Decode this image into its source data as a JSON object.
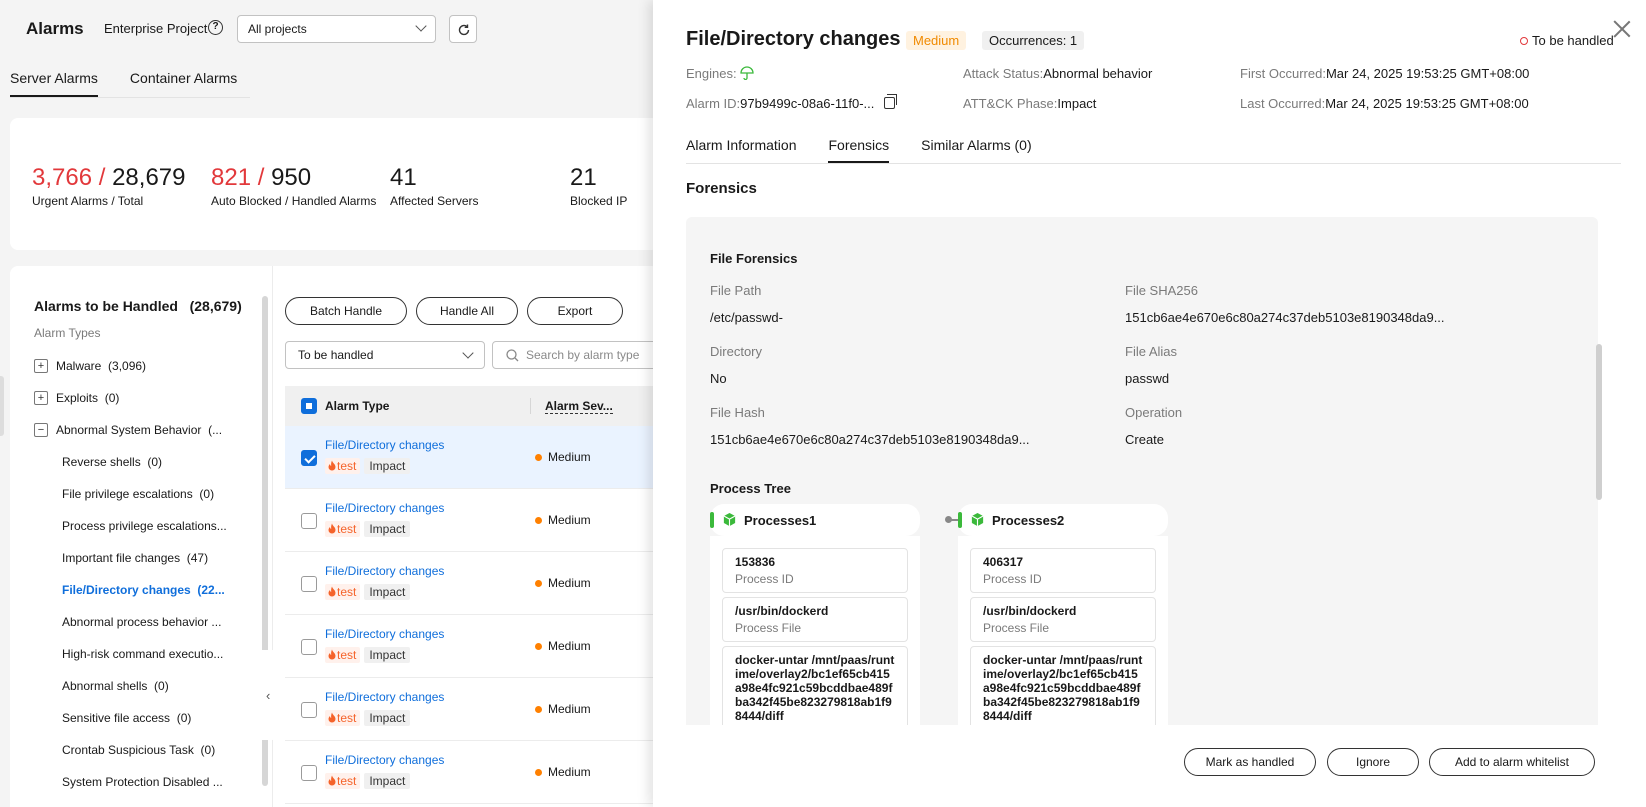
{
  "page": {
    "title": "Alarms",
    "enterprise_project_label": "Enterprise Project",
    "help_glyph": "?",
    "project_select_value": "All projects",
    "tabs": [
      "Server Alarms",
      "Container Alarms"
    ]
  },
  "stats": [
    {
      "value_red": "3,766",
      "sep": " / ",
      "value": "28,679",
      "label": "Urgent Alarms  / Total"
    },
    {
      "value_red": "821",
      "sep": " / ",
      "value": "950",
      "label": "Auto Blocked  / Handled Alarms"
    },
    {
      "value_red": "",
      "sep": "",
      "value": "41",
      "label": "Affected Servers"
    },
    {
      "value_red": "",
      "sep": "",
      "value": "21",
      "label": "Blocked IP"
    }
  ],
  "alarm_list": {
    "title": "Alarms to be Handled",
    "count": "(28,679)",
    "subtitle": "Alarm Types",
    "tree": [
      {
        "label": "Malware",
        "count": "(3,096)",
        "expand": "+"
      },
      {
        "label": "Exploits",
        "count": "(0)",
        "expand": "+"
      },
      {
        "label": "Abnormal System Behavior",
        "count": "(...",
        "expand": "−"
      },
      {
        "label": "Reverse shells",
        "count": "(0)"
      },
      {
        "label": "File privilege escalations",
        "count": "(0)"
      },
      {
        "label": "Process privilege escalations...",
        "count": ""
      },
      {
        "label": "Important file changes",
        "count": "(47)"
      },
      {
        "label": "File/Directory changes",
        "count": "(22...",
        "active": true
      },
      {
        "label": "Abnormal process behavior ...",
        "count": ""
      },
      {
        "label": "High-risk command executio...",
        "count": ""
      },
      {
        "label": "Abnormal shells",
        "count": "(0)"
      },
      {
        "label": "Sensitive file access",
        "count": "(0)"
      },
      {
        "label": "Crontab Suspicious Task",
        "count": "(0)"
      },
      {
        "label": "System Protection Disabled ...",
        "count": ""
      }
    ],
    "collapse_glyph": "‹"
  },
  "toolbar": {
    "batch_handle": "Batch Handle",
    "handle_all": "Handle All",
    "export": "Export",
    "status_filter": "To be handled",
    "search_placeholder": "Search by alarm type"
  },
  "table": {
    "headers": [
      "Alarm Type",
      "Alarm Sev..."
    ],
    "rows": [
      {
        "name": "File/Directory changes",
        "tag1": "test",
        "tag2": "Impact",
        "severity": "Medium",
        "checked": true
      },
      {
        "name": "File/Directory changes",
        "tag1": "test",
        "tag2": "Impact",
        "severity": "Medium",
        "checked": false
      },
      {
        "name": "File/Directory changes",
        "tag1": "test",
        "tag2": "Impact",
        "severity": "Medium",
        "checked": false
      },
      {
        "name": "File/Directory changes",
        "tag1": "test",
        "tag2": "Impact",
        "severity": "Medium",
        "checked": false
      },
      {
        "name": "File/Directory changes",
        "tag1": "test",
        "tag2": "Impact",
        "severity": "Medium",
        "checked": false
      },
      {
        "name": "File/Directory changes",
        "tag1": "test",
        "tag2": "Impact",
        "severity": "Medium",
        "checked": false
      }
    ]
  },
  "drawer": {
    "title": "File/Directory changes",
    "severity_badge": "Medium",
    "occurrences": "Occurrences: 1",
    "status": "To be handled",
    "meta": {
      "engines_label": "Engines:",
      "alarm_id_label": "Alarm ID:",
      "alarm_id": "97b9499c-08a6-11f0-...",
      "attack_status_label": "Attack Status:",
      "attack_status": "Abnormal behavior",
      "attck_phase_label": "ATT&CK Phase:",
      "attck_phase": "Impact",
      "first_occurred_label": "First Occurred:",
      "first_occurred": "Mar 24, 2025 19:53:25 GMT+08:00",
      "last_occurred_label": "Last Occurred:",
      "last_occurred": "Mar 24, 2025 19:53:25 GMT+08:00"
    },
    "tabs": [
      "Alarm Information",
      "Forensics",
      "Similar Alarms   (0)"
    ],
    "section_title": "Forensics",
    "file_forensics": {
      "title": "File Forensics",
      "fields": [
        {
          "label": "File Path",
          "value": "/etc/passwd-"
        },
        {
          "label": "File SHA256",
          "value": "151cb6ae4e670e6c80a274c37deb5103e8190348da9..."
        },
        {
          "label": "Directory",
          "value": "No"
        },
        {
          "label": "File Alias",
          "value": "passwd"
        },
        {
          "label": "File Hash",
          "value": "151cb6ae4e670e6c80a274c37deb5103e8190348da9..."
        },
        {
          "label": "Operation",
          "value": "Create"
        }
      ]
    },
    "process_tree": {
      "title": "Process Tree",
      "processes": [
        {
          "name": "Processes1",
          "pid": "153836",
          "pid_label": "Process ID",
          "file": "/usr/bin/dockerd",
          "file_label": "Process File",
          "cmd": "docker-untar /mnt/paas/runtime/overlay2/bc1ef65cb415a98e4fc921c59bcddbae489fba342f45be823279818ab1f98444/diff"
        },
        {
          "name": "Processes2",
          "pid": "406317",
          "pid_label": "Process ID",
          "file": "/usr/bin/dockerd",
          "file_label": "Process File",
          "cmd": "docker-untar /mnt/paas/runtime/overlay2/bc1ef65cb415a98e4fc921c59bcddbae489fba342f45be823279818ab1f98444/diff"
        }
      ]
    },
    "footer": {
      "mark_handled": "Mark as handled",
      "ignore": "Ignore",
      "whitelist": "Add to alarm whitelist"
    }
  },
  "colors": {
    "accent_blue": "#0f6edb",
    "urgent_red": "#e2383b",
    "medium_orange": "#ff8000",
    "engine_green": "#3bb93b"
  },
  "icons": [
    "help-icon",
    "chevron-down-icon",
    "refresh-icon",
    "search-icon",
    "fire-icon",
    "umbrella-icon",
    "copy-icon",
    "close-icon",
    "cube-icon",
    "chevron-left-icon"
  ]
}
